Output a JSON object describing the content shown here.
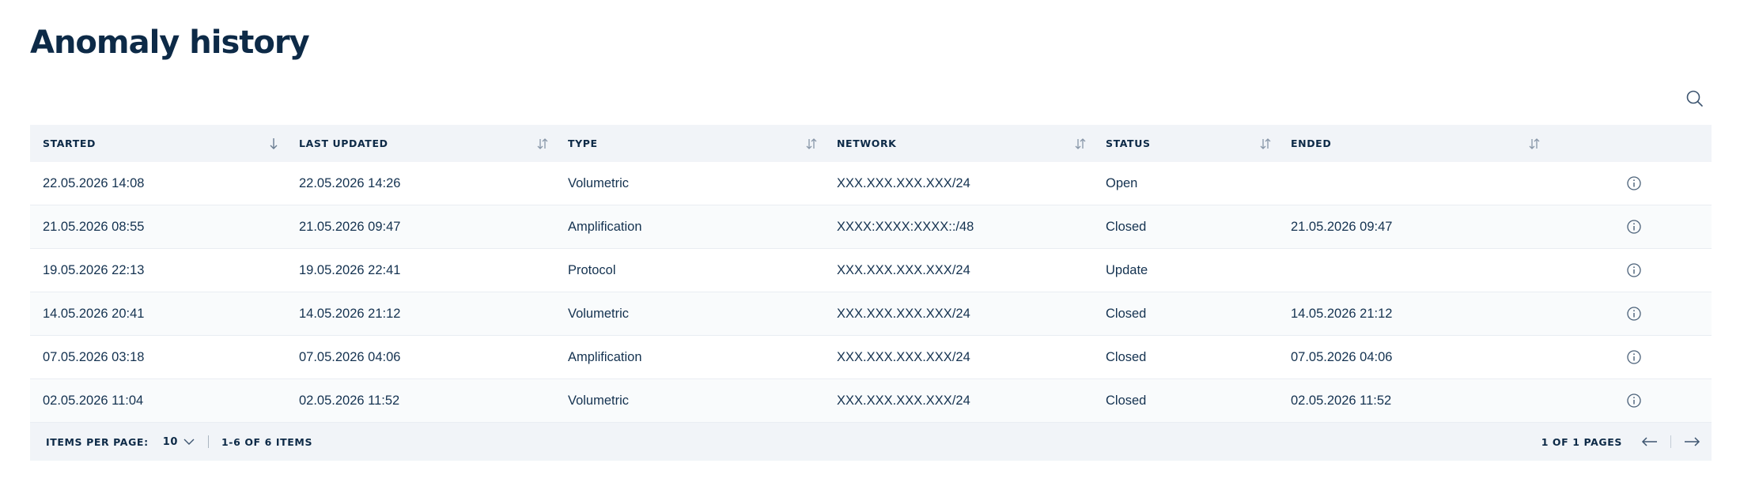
{
  "page": {
    "title": "Anomaly history"
  },
  "table": {
    "columns": [
      {
        "label": "STARTED",
        "sort": "desc"
      },
      {
        "label": "LAST UPDATED",
        "sort": "none"
      },
      {
        "label": "TYPE",
        "sort": "none"
      },
      {
        "label": "NETWORK",
        "sort": "none"
      },
      {
        "label": "STATUS",
        "sort": "none"
      },
      {
        "label": "ENDED",
        "sort": "none"
      }
    ],
    "rows": [
      {
        "started": "22.05.2026 14:08",
        "last_updated": "22.05.2026 14:26",
        "type": "Volumetric",
        "network": "XXX.XXX.XXX.XXX/24",
        "status": "Open",
        "ended": ""
      },
      {
        "started": "21.05.2026 08:55",
        "last_updated": "21.05.2026 09:47",
        "type": "Amplification",
        "network": "XXXX:XXXX:XXXX::/48",
        "status": "Closed",
        "ended": "21.05.2026 09:47"
      },
      {
        "started": "19.05.2026 22:13",
        "last_updated": "19.05.2026 22:41",
        "type": "Protocol",
        "network": "XXX.XXX.XXX.XXX/24",
        "status": "Update",
        "ended": ""
      },
      {
        "started": "14.05.2026 20:41",
        "last_updated": "14.05.2026 21:12",
        "type": "Volumetric",
        "network": "XXX.XXX.XXX.XXX/24",
        "status": "Closed",
        "ended": "14.05.2026 21:12"
      },
      {
        "started": "07.05.2026 03:18",
        "last_updated": "07.05.2026 04:06",
        "type": "Amplification",
        "network": "XXX.XXX.XXX.XXX/24",
        "status": "Closed",
        "ended": "07.05.2026 04:06"
      },
      {
        "started": "02.05.2026 11:04",
        "last_updated": "02.05.2026 11:52",
        "type": "Volumetric",
        "network": "XXX.XXX.XXX.XXX/24",
        "status": "Closed",
        "ended": "02.05.2026 11:52"
      }
    ]
  },
  "footer": {
    "items_per_page_label": "ITEMS PER PAGE:",
    "items_per_page_value": "10",
    "items_range": "1-6 OF 6 ITEMS",
    "page_info": "1 OF 1 PAGES"
  },
  "icons": {
    "search": "search-icon",
    "sort": "sort-icon",
    "info": "info-icon",
    "prev": "arrow-left-icon",
    "next": "arrow-right-icon",
    "dropdown": "chevron-down-icon"
  },
  "colors": {
    "title": "#0d2a47",
    "header_bg": "#f1f4f8",
    "row_alt_bg": "#f9fbfc",
    "text": "#143250",
    "icon": "#4a6078"
  }
}
